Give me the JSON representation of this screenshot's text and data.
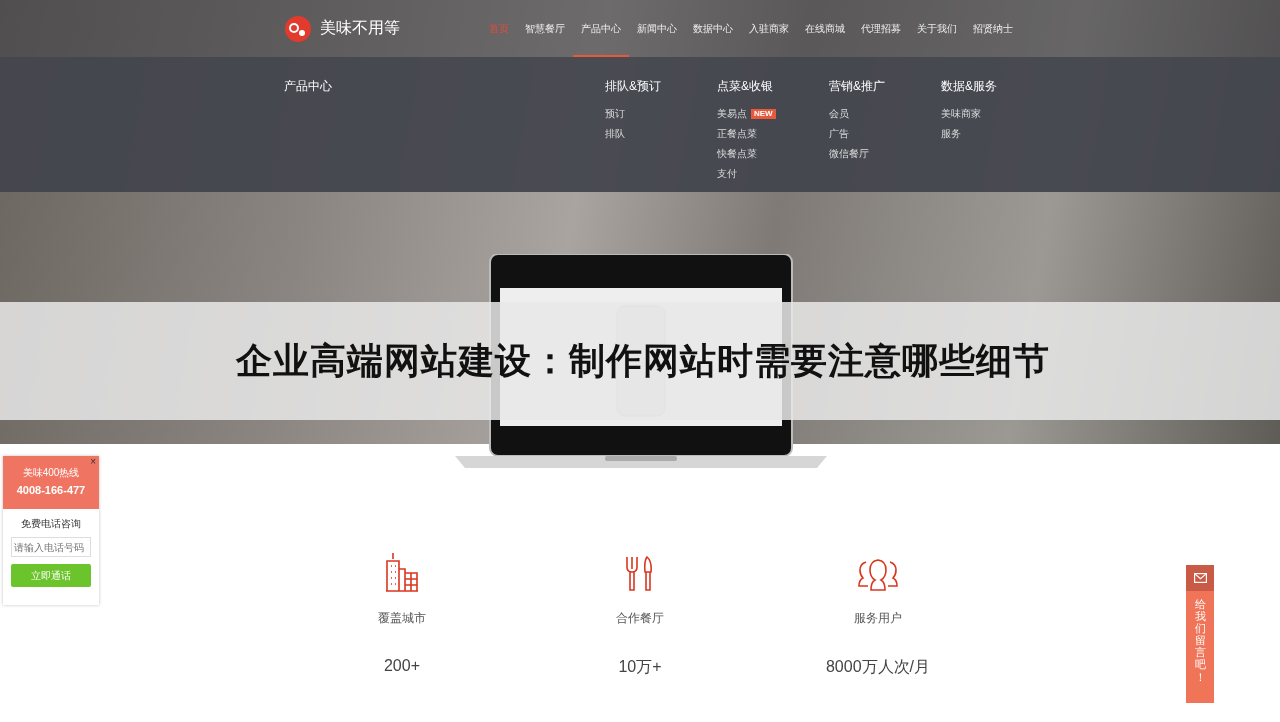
{
  "header": {
    "logo_text": "美味不用等",
    "nav": [
      {
        "label": "首页",
        "selected": true,
        "open": false
      },
      {
        "label": "智慧餐厅",
        "selected": false,
        "open": false
      },
      {
        "label": "产品中心",
        "selected": false,
        "open": true
      },
      {
        "label": "新闻中心",
        "selected": false,
        "open": false
      },
      {
        "label": "数据中心",
        "selected": false,
        "open": false
      },
      {
        "label": "入驻商家",
        "selected": false,
        "open": false
      },
      {
        "label": "在线商城",
        "selected": false,
        "open": false
      },
      {
        "label": "代理招募",
        "selected": false,
        "open": false
      },
      {
        "label": "关于我们",
        "selected": false,
        "open": false
      },
      {
        "label": "招贤纳士",
        "selected": false,
        "open": false
      }
    ]
  },
  "mega_menu": {
    "title": "产品中心",
    "columns": [
      {
        "heading": "排队&预订",
        "items": [
          {
            "label": "预订"
          },
          {
            "label": "排队"
          }
        ]
      },
      {
        "heading": "点菜&收银",
        "items": [
          {
            "label": "美易点",
            "badge": "NEW"
          },
          {
            "label": "正餐点菜"
          },
          {
            "label": "快餐点菜"
          },
          {
            "label": "支付"
          }
        ]
      },
      {
        "heading": "营销&推广",
        "items": [
          {
            "label": "会员"
          },
          {
            "label": "广告"
          },
          {
            "label": "微信餐厅"
          }
        ]
      },
      {
        "heading": "数据&服务",
        "items": [
          {
            "label": "美味商家"
          },
          {
            "label": "服务"
          }
        ]
      }
    ]
  },
  "title_banner": "企业高端网站建设：制作网站时需要注意哪些细节",
  "stats": [
    {
      "kind": "city",
      "label": "覆盖城市",
      "value": "200+"
    },
    {
      "kind": "restaurant",
      "label": "合作餐厅",
      "value": "10万+"
    },
    {
      "kind": "users",
      "label": "服务用户",
      "value": "8000万人次/月"
    }
  ],
  "call_widget": {
    "close": "×",
    "title": "美味400热线",
    "phone": "4008-166-477",
    "prompt": "免费电话咨询",
    "placeholder": "请输入电话号码",
    "button": "立即通话"
  },
  "message_tab": {
    "label": "给我们留言吧！"
  }
}
